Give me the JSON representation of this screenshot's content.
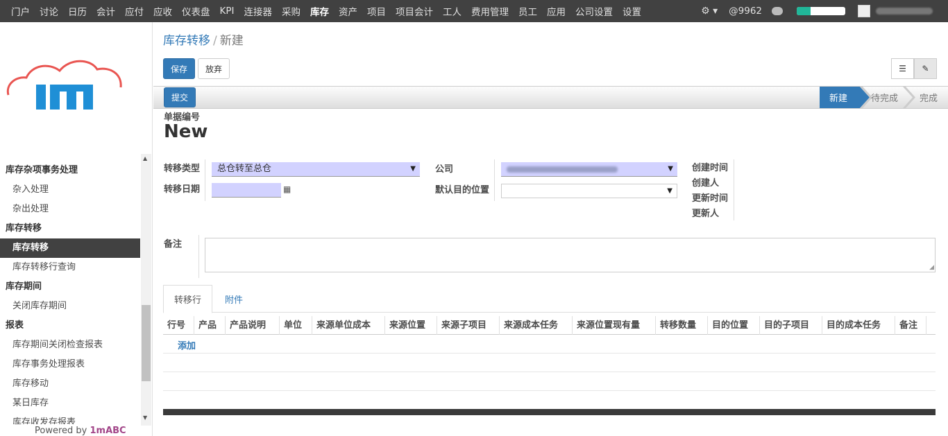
{
  "topbar": {
    "menu": [
      "门户",
      "讨论",
      "日历",
      "会计",
      "应付",
      "应收",
      "仪表盘",
      "KPI",
      "连接器",
      "采购",
      "库存",
      "资产",
      "项目",
      "项目会计",
      "工人",
      "费用管理",
      "员工",
      "应用",
      "公司设置",
      "设置"
    ],
    "active_menu": "库存",
    "mentions": "@9962",
    "progress": 0.28,
    "icons": [
      "gear-icon",
      "chat-icon",
      "avatar"
    ]
  },
  "sidebar": {
    "logo_text": "1m",
    "sections": [
      {
        "header": "库存杂项事务处理",
        "items": [
          "杂入处理",
          "杂出处理"
        ]
      },
      {
        "header": "库存转移",
        "items": [
          "库存转移",
          "库存转移行查询"
        ]
      },
      {
        "header": "库存期间",
        "items": [
          "关闭库存期间"
        ]
      },
      {
        "header": "报表",
        "items": [
          "库存期间关闭检查报表",
          "库存事务处理报表",
          "库存移动",
          "某日库存",
          "库存收发存报表"
        ]
      }
    ],
    "active_item": "库存转移",
    "powered_by": "Powered by ",
    "powered_brand": "1mABC"
  },
  "breadcrumb": {
    "parent": "库存转移",
    "separator": "/",
    "current": "新建"
  },
  "buttons": {
    "save": "保存",
    "discard": "放弃",
    "submit": "提交"
  },
  "status_stages": [
    "新建",
    "待完成",
    "完成"
  ],
  "form": {
    "number_label": "单据编号",
    "number_value": "New",
    "transfer_type_label": "转移类型",
    "transfer_type_value": "总仓转至总仓",
    "transfer_date_label": "转移日期",
    "company_label": "公司",
    "default_dest_label": "默认目的位置",
    "meta_labels": [
      "创建时间",
      "创建人",
      "更新时间",
      "更新人"
    ],
    "note_label": "备注"
  },
  "tabs": [
    "转移行",
    "附件"
  ],
  "grid": {
    "columns": [
      "行号",
      "产品",
      "产品说明",
      "单位",
      "来源单位成本",
      "来源位置",
      "来源子项目",
      "来源成本任务",
      "来源位置现有量",
      "转移数量",
      "目的位置",
      "目的子项目",
      "目的成本任务",
      "备注"
    ],
    "add_label": "添加"
  }
}
